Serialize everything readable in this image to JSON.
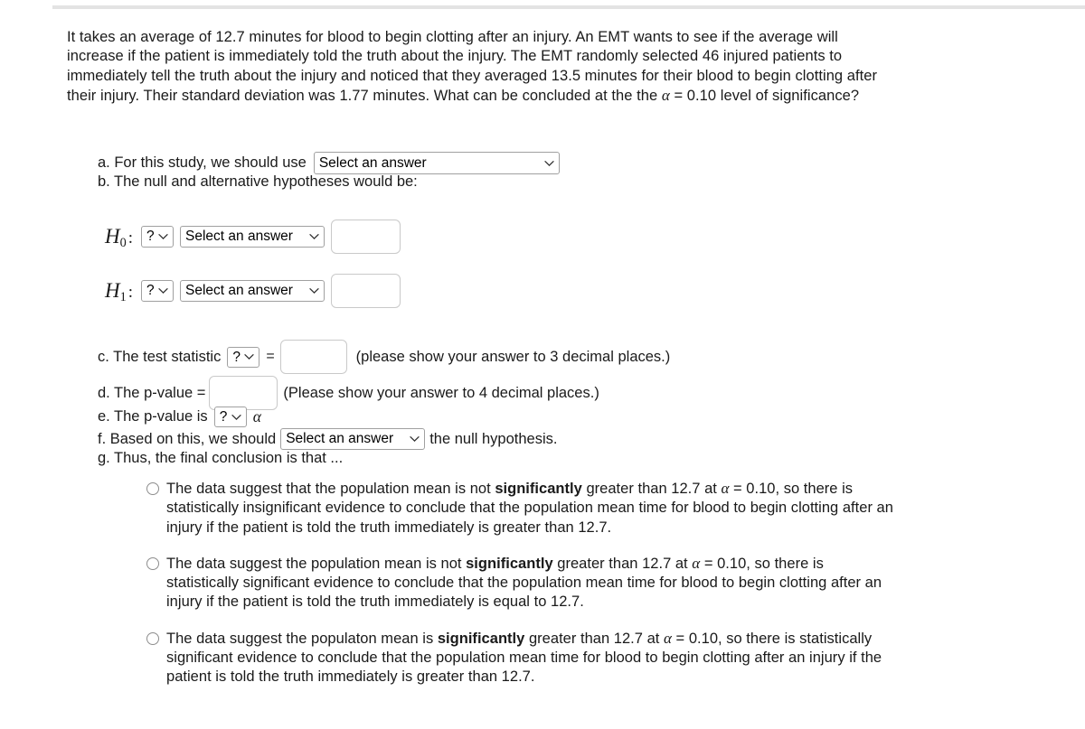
{
  "problem": {
    "text_part1": "It takes an average of 12.7 minutes for blood to begin clotting after an injury.  An EMT wants to see if the average will increase if the patient is immediately told the truth about the injury. The EMT randomly selected 46 injured patients to immediately tell the truth about the injury and noticed that they averaged 13.5 minutes for their blood to begin clotting after their injury. Their standard deviation was 1.77 minutes. What can be concluded at the the ",
    "alpha_symbol": "α",
    "text_part2": " = 0.10 level of significance?",
    "mean": "12.7",
    "sample_size": "46",
    "sample_mean": "13.5",
    "std_dev": "1.77",
    "alpha_level": "0.10"
  },
  "item_a": {
    "label": "a. For this study, we should use",
    "select_value": "Select an answer"
  },
  "item_b": {
    "label": "b. The null and alternative hypotheses would be:"
  },
  "hypotheses": {
    "null": {
      "symbol": "H",
      "subscript": "0",
      "colon": ":",
      "operator_value": "?",
      "parameter_value": "Select an answer",
      "value_input": ""
    },
    "alt": {
      "symbol": "H",
      "subscript": "1",
      "colon": ":",
      "operator_value": "?",
      "parameter_value": "Select an answer",
      "value_input": ""
    }
  },
  "item_c": {
    "label": "c. The test statistic",
    "statistic_value": "?",
    "equals": "=",
    "input_value": "",
    "note": "(please show your answer to 3 decimal places.)"
  },
  "item_d": {
    "label": "d. The p-value =",
    "input_value": "",
    "note": "(Please show your answer to 4 decimal places.)"
  },
  "item_e": {
    "label": "e. The p-value is",
    "comparison_value": "?",
    "alpha_symbol": "α"
  },
  "item_f": {
    "label_before": "f. Based on this, we should",
    "select_value": "Select an answer",
    "label_after": "the null hypothesis."
  },
  "item_g": {
    "label": "g. Thus, the final conclusion is that ..."
  },
  "options": [
    {
      "part1": "The data suggest that the population mean is not ",
      "bold": "significantly",
      "part2": " greater than 12.7 at ",
      "alpha": "α",
      "part3": " = 0.10, so there is statistically insignificant evidence to conclude that the population mean time for blood to begin clotting after an injury if the patient is told the truth immediately is greater than 12.7.",
      "selected": false
    },
    {
      "part1": "The data suggest the population mean is not ",
      "bold": "significantly",
      "part2": " greater than 12.7 at ",
      "alpha": "α",
      "part3": " = 0.10, so there is statistically significant evidence to conclude that the population mean time for blood to begin clotting after an injury if the patient is told the truth immediately is equal to 12.7.",
      "selected": false
    },
    {
      "part1": "The data suggest the populaton mean is ",
      "bold": "significantly",
      "part2": " greater than 12.7 at ",
      "alpha": "α",
      "part3": " = 0.10, so there is statistically significant evidence to conclude that the population mean time for blood to begin clotting after an injury if the patient is told the truth immediately is greater than 12.7.",
      "selected": false
    }
  ],
  "colors": {
    "top_bar": "#e3e3e3",
    "text": "#1a1a1a",
    "select_border": "#a0a0a0",
    "input_border": "#c9c9c9"
  }
}
